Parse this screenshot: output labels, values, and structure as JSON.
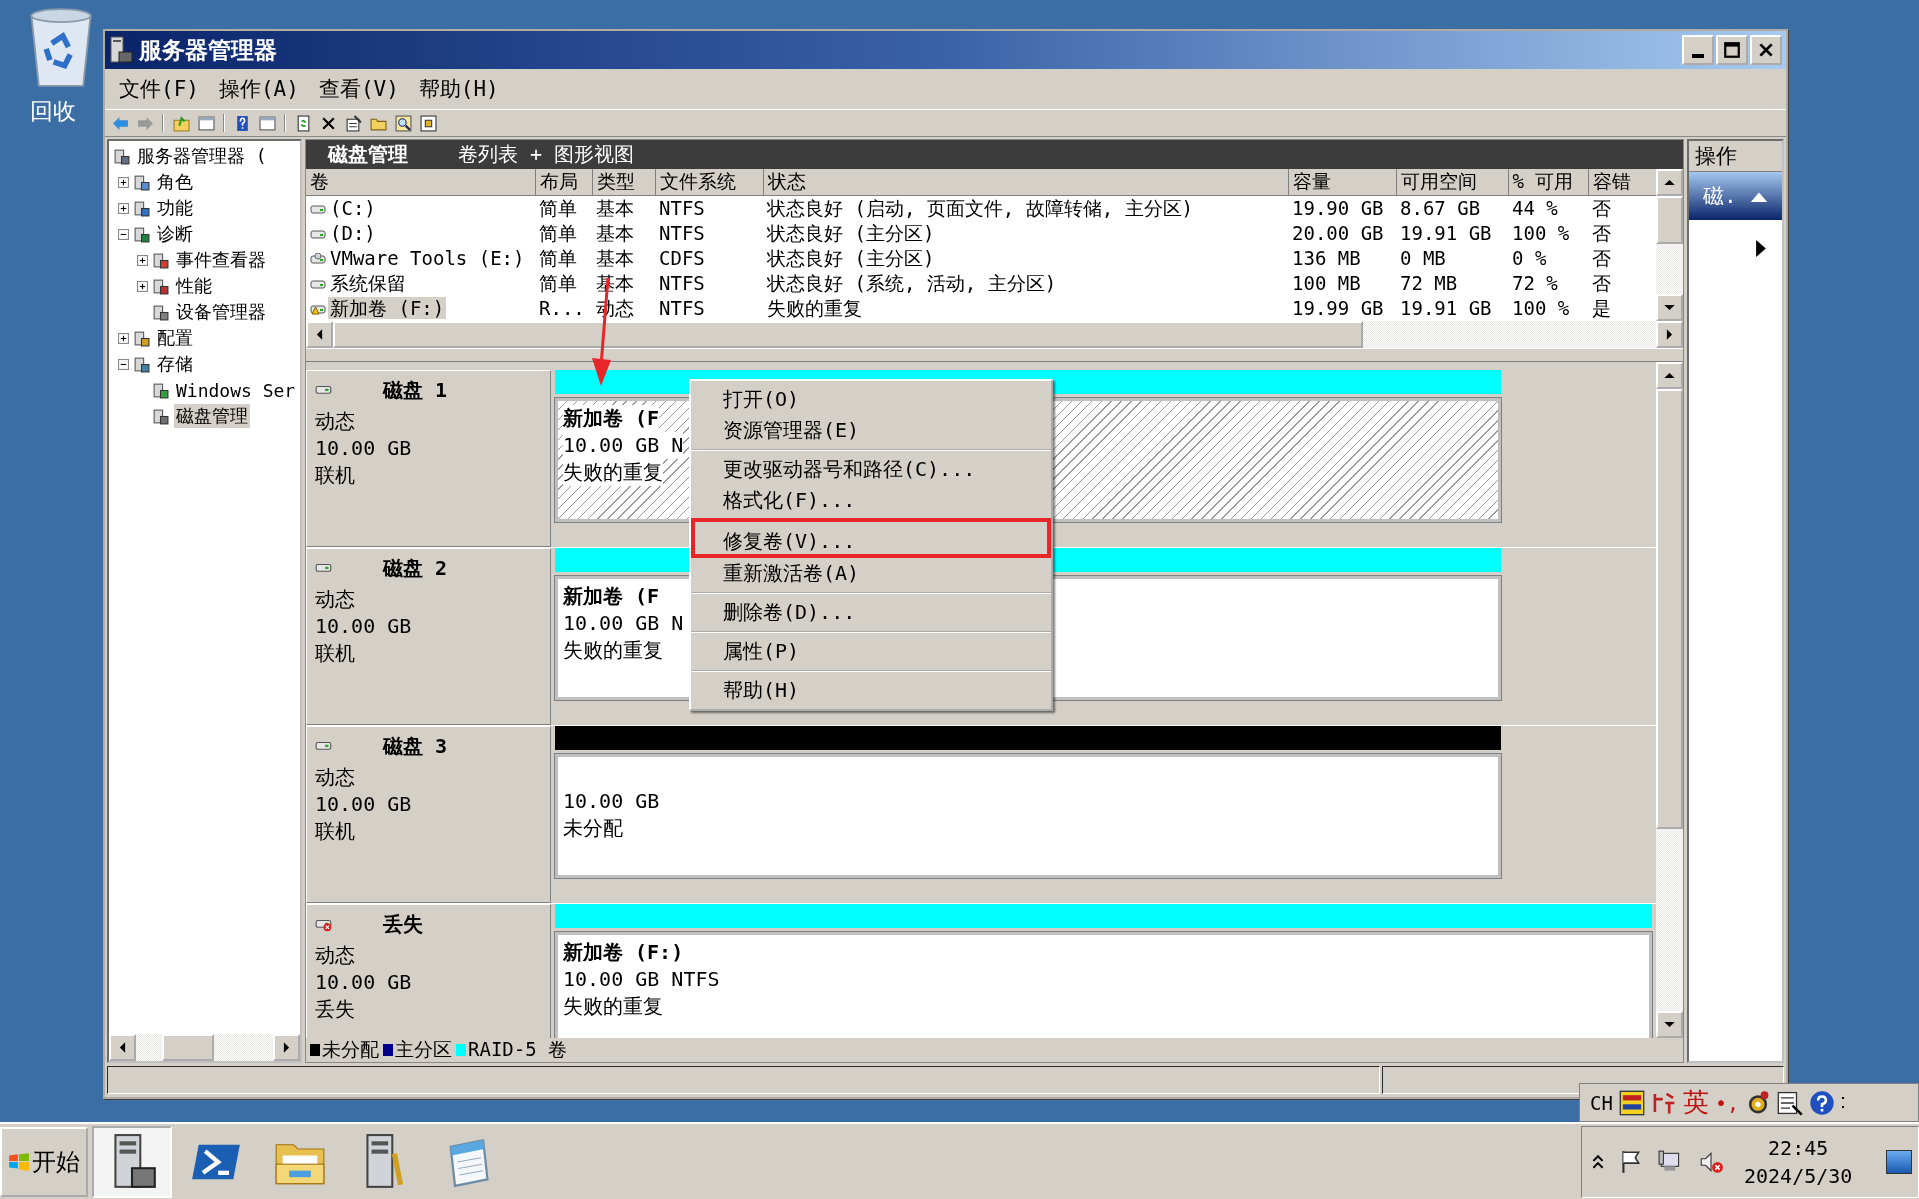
{
  "desktop": {
    "icons": [
      {
        "label": "回收"
      }
    ]
  },
  "window": {
    "title": "服务器管理器"
  },
  "menu_bar": [
    {
      "label": "文件(F)"
    },
    {
      "label": "操作(A)"
    },
    {
      "label": "查看(V)"
    },
    {
      "label": "帮助(H)"
    }
  ],
  "tree": [
    {
      "label": "服务器管理器 (",
      "kind": "server",
      "selected": false,
      "children": [
        {
          "label": "角色",
          "kind": "roles",
          "expanded": false,
          "selected": false
        },
        {
          "label": "功能",
          "kind": "features",
          "expanded": false,
          "selected": false
        },
        {
          "label": "诊断",
          "kind": "diagnostics",
          "expanded": true,
          "selected": false,
          "children": [
            {
              "label": "事件查看器",
              "kind": "events",
              "expanded": false,
              "selected": false
            },
            {
              "label": "性能",
              "kind": "performance",
              "expanded": false,
              "selected": false
            },
            {
              "label": "设备管理器",
              "kind": "devices",
              "selected": false
            }
          ]
        },
        {
          "label": "配置",
          "kind": "configuration",
          "expanded": false,
          "selected": false
        },
        {
          "label": "存储",
          "kind": "storage",
          "expanded": true,
          "selected": false,
          "children": [
            {
              "label": "Windows Ser",
              "kind": "backup",
              "selected": false
            },
            {
              "label": "磁盘管理",
              "kind": "disk",
              "selected": true
            }
          ]
        }
      ]
    }
  ],
  "panel": {
    "title": "磁盘管理",
    "subtitle": "卷列表 + 图形视图"
  },
  "table": {
    "columns": [
      "卷",
      "布局",
      "类型",
      "文件系统",
      "状态",
      "容量",
      "可用空间",
      "% 可用",
      "容错"
    ],
    "rows": [
      {
        "kind": "disk",
        "selected": false,
        "cells": [
          "(C:)",
          "简单",
          "基本",
          "NTFS",
          "状态良好 (启动, 页面文件, 故障转储, 主分区)",
          "19.90 GB",
          "8.67 GB",
          "44 %",
          "否"
        ]
      },
      {
        "kind": "disk",
        "selected": false,
        "cells": [
          "(D:)",
          "简单",
          "基本",
          "NTFS",
          "状态良好 (主分区)",
          "20.00 GB",
          "19.91 GB",
          "100 %",
          "否"
        ]
      },
      {
        "kind": "cdrom",
        "selected": false,
        "cells": [
          "VMware Tools (E:)",
          "简单",
          "基本",
          "CDFS",
          "状态良好 (主分区)",
          "136 MB",
          "0 MB",
          "0 %",
          "否"
        ]
      },
      {
        "kind": "disk",
        "selected": false,
        "cells": [
          "系统保留",
          "简单",
          "基本",
          "NTFS",
          "状态良好 (系统, 活动, 主分区)",
          "100 MB",
          "72 MB",
          "72 %",
          "否"
        ]
      },
      {
        "kind": "warning",
        "selected": true,
        "cells": [
          "新加卷 (F:)",
          "R...",
          "动态",
          "NTFS",
          "失败的重复",
          "19.99 GB",
          "19.91 GB",
          "100 %",
          "是"
        ]
      }
    ]
  },
  "disks": [
    {
      "kind": "online",
      "name": "磁盘 1",
      "type": "动态",
      "size": "10.00 GB",
      "status": "联机",
      "volume": {
        "kind": "raid5",
        "selected": true,
        "name": "新加卷 (F",
        "detail": "10.00 GB N",
        "status": "失败的重复"
      }
    },
    {
      "kind": "online",
      "name": "磁盘 2",
      "type": "动态",
      "size": "10.00 GB",
      "status": "联机",
      "volume": {
        "kind": "raid5",
        "selected": false,
        "name": "新加卷 (F",
        "detail": "10.00 GB N",
        "status": "失败的重复"
      }
    },
    {
      "kind": "online",
      "name": "磁盘 3",
      "type": "动态",
      "size": "10.00 GB",
      "status": "联机",
      "volume": {
        "kind": "unallocated",
        "selected": false,
        "detail": "10.00 GB",
        "status": "未分配"
      }
    },
    {
      "kind": "missing",
      "name": "丢失",
      "type": "动态",
      "size": "10.00 GB",
      "status": "丢失",
      "volume": {
        "kind": "raid5",
        "selected": false,
        "name": "新加卷 (F:)",
        "detail": "10.00 GB NTFS",
        "status": "失败的重复"
      }
    }
  ],
  "legend": [
    {
      "label": "未分配",
      "color": "#000000"
    },
    {
      "label": "主分区",
      "color": "#00008b"
    },
    {
      "label": "RAID-5 卷",
      "color": "#00ffff"
    }
  ],
  "actions": {
    "title": "操作",
    "items": [
      {
        "label": "磁.",
        "expanded": true
      }
    ]
  },
  "context_menu": {
    "groups": [
      [
        {
          "label": "打开(O)",
          "highlighted": false
        },
        {
          "label": "资源管理器(E)",
          "highlighted": false
        }
      ],
      [
        {
          "label": "更改驱动器号和路径(C)...",
          "highlighted": false
        },
        {
          "label": "格式化(F)...",
          "highlighted": false
        }
      ],
      [
        {
          "label": "修复卷(V)...",
          "highlighted": true
        },
        {
          "label": "重新激活卷(A)",
          "highlighted": false
        }
      ],
      [
        {
          "label": "删除卷(D)...",
          "highlighted": false
        }
      ],
      [
        {
          "label": "属性(P)",
          "highlighted": false
        }
      ],
      [
        {
          "label": "帮助(H)",
          "highlighted": false
        }
      ]
    ]
  },
  "language_bar": {
    "language": "CH",
    "mode": "英",
    "punctuation": "•,"
  },
  "taskbar": {
    "start": "开始",
    "apps": [
      {
        "kind": "server-manager",
        "selected": true
      },
      {
        "kind": "powershell",
        "selected": false
      },
      {
        "kind": "explorer",
        "selected": false
      },
      {
        "kind": "server-tools",
        "selected": false
      },
      {
        "kind": "notepad",
        "selected": false
      }
    ],
    "tray": {
      "speaker_muted": true
    },
    "clock": {
      "time": "22:45",
      "date": "2024/5/30"
    }
  }
}
